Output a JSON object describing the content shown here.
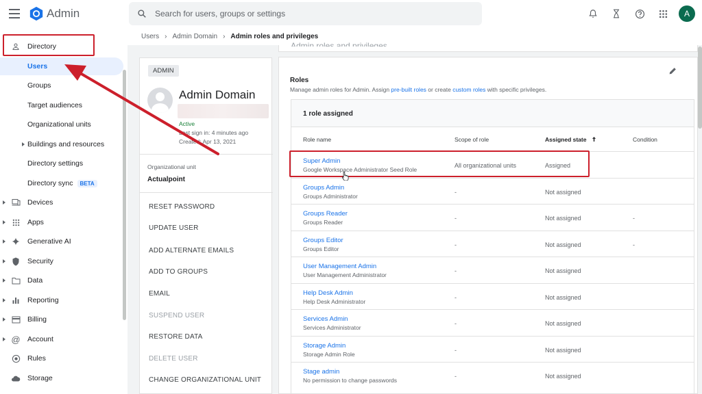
{
  "topbar": {
    "brand": "Admin",
    "search_placeholder": "Search for users, groups or settings",
    "avatar_letter": "A"
  },
  "sidebar": {
    "directory": "Directory",
    "sub": [
      "Users",
      "Groups",
      "Target audiences",
      "Organizational units",
      "Buildings and resources",
      "Directory settings",
      "Directory sync"
    ],
    "beta": "BETA",
    "items": [
      "Devices",
      "Apps",
      "Generative AI",
      "Security",
      "Data",
      "Reporting",
      "Billing",
      "Account",
      "Rules",
      "Storage"
    ]
  },
  "breadcrumb": [
    "Users",
    "Admin Domain",
    "Admin roles and privileges"
  ],
  "user": {
    "chip": "ADMIN",
    "name": "Admin Domain",
    "status": "Active",
    "last_signin": "Last sign in: 4 minutes ago",
    "created": "Created: Apr 13, 2021",
    "ou_label": "Organizational unit",
    "ou_value": "Actualpoint",
    "actions": [
      "RESET PASSWORD",
      "UPDATE USER",
      "ADD ALTERNATE EMAILS",
      "ADD TO GROUPS",
      "EMAIL",
      "SUSPEND USER",
      "RESTORE DATA",
      "DELETE USER",
      "CHANGE ORGANIZATIONAL UNIT"
    ]
  },
  "roles": {
    "panel_title": "Admin roles and privileges",
    "title": "Roles",
    "desc_pre": "Manage admin roles for Admin. Assign ",
    "desc_link1": "pre-built roles",
    "desc_mid": " or create ",
    "desc_link2": "custom roles",
    "desc_post": " with specific privileges.",
    "assigned_count": "1 role assigned",
    "columns": [
      "Role name",
      "Scope of role",
      "Assigned state",
      "Condition"
    ],
    "rows": [
      {
        "name": "Super Admin",
        "desc": "Google Workspace Administrator Seed Role",
        "scope": "All organizational units",
        "state": "Assigned",
        "cond": ""
      },
      {
        "name": "Groups Admin",
        "desc": "Groups Administrator",
        "scope": "-",
        "state": "Not assigned",
        "cond": ""
      },
      {
        "name": "Groups Reader",
        "desc": "Groups Reader",
        "scope": "-",
        "state": "Not assigned",
        "cond": "-"
      },
      {
        "name": "Groups Editor",
        "desc": "Groups Editor",
        "scope": "-",
        "state": "Not assigned",
        "cond": "-"
      },
      {
        "name": "User Management Admin",
        "desc": "User Management Administrator",
        "scope": "-",
        "state": "Not assigned",
        "cond": ""
      },
      {
        "name": "Help Desk Admin",
        "desc": "Help Desk Administrator",
        "scope": "-",
        "state": "Not assigned",
        "cond": ""
      },
      {
        "name": "Services Admin",
        "desc": "Services Administrator",
        "scope": "-",
        "state": "Not assigned",
        "cond": ""
      },
      {
        "name": "Storage Admin",
        "desc": "Storage Admin Role",
        "scope": "-",
        "state": "Not assigned",
        "cond": ""
      },
      {
        "name": "Stage admin",
        "desc": "No permission to change passwords",
        "scope": "-",
        "state": "Not assigned",
        "cond": ""
      }
    ]
  },
  "colors": {
    "accent": "#1a73e8",
    "annotation": "#cc1f2b",
    "active_green": "#188038"
  }
}
